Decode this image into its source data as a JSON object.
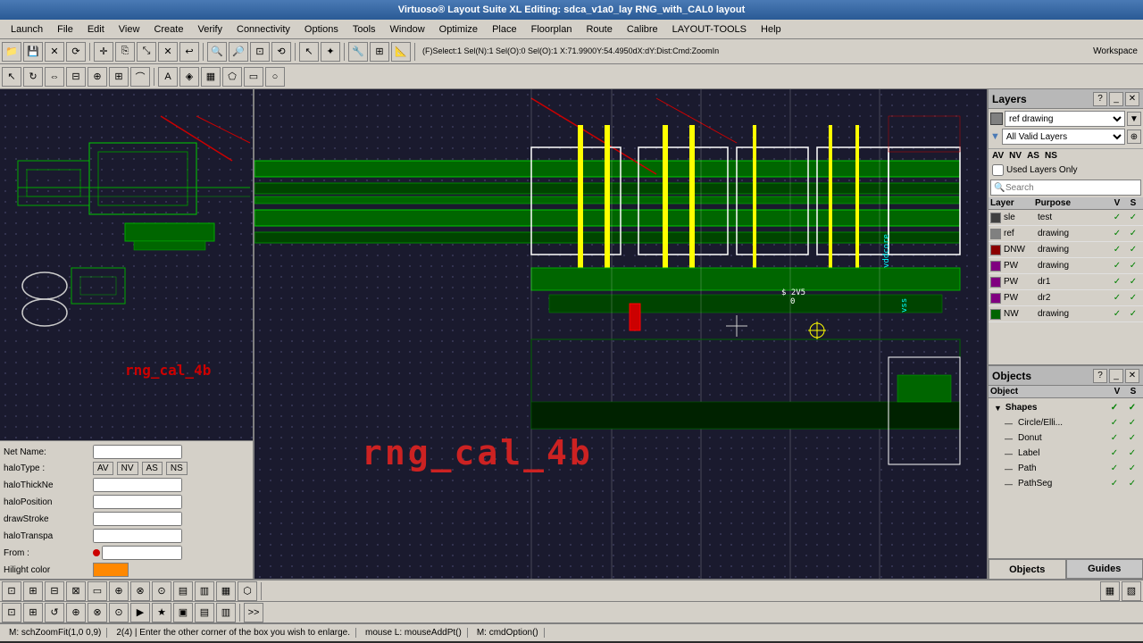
{
  "titlebar": {
    "text": "Virtuoso® Layout Suite XL Editing: sdca_v1a0_lay RNG_with_CAL0 layout"
  },
  "menubar": {
    "items": [
      "Launch",
      "File",
      "Edit",
      "View",
      "Create",
      "Verify",
      "Connectivity",
      "Options",
      "Tools",
      "Window",
      "Optimize",
      "Place",
      "Floorplan",
      "Route",
      "Calibre",
      "LAYOUT-TOOLS",
      "Help"
    ]
  },
  "toolbar": {
    "workspace_label": "Workspace",
    "net_name_label": "Net Name:",
    "halotype_label": "haloType :",
    "halotype_tabs": [
      "AV",
      "NV",
      "AS",
      "NS"
    ],
    "halothickne_label": "haloThickNe",
    "haloposition_label": "haloPosition",
    "drawstroke_label": "drawStroke",
    "halotranspa_label": "haloTranspa",
    "from_label": "From :",
    "hilight_color_label": "Hilight color"
  },
  "statusbar_top": {
    "text": "(F)Select:1 Sel(N):1 Sel(O):0 Sel(O):1  X:71.9900Y:54.4950dX:dY:Dist:Cmd:ZoomIn"
  },
  "layers_panel": {
    "title": "Layers",
    "filter_tabs": [
      "AV",
      "NV",
      "AS",
      "NS"
    ],
    "ref_drawing_label": "ref drawing",
    "all_valid_label": "All Valid Layers",
    "used_only_label": "Used Layers Only",
    "search_placeholder": "Search",
    "col_layer": "Layer",
    "col_purpose": "Purpose",
    "col_v": "V",
    "col_s": "S",
    "rows": [
      {
        "name": "sle",
        "purpose": "test",
        "v": true,
        "s": true,
        "color": "#404040"
      },
      {
        "name": "ref",
        "purpose": "drawing",
        "v": true,
        "s": true,
        "color": "#808080"
      },
      {
        "name": "DNW",
        "purpose": "drawing",
        "v": true,
        "s": true,
        "color": "#8B0000"
      },
      {
        "name": "PW",
        "purpose": "drawing",
        "v": true,
        "s": true,
        "color": "#800080"
      },
      {
        "name": "PW",
        "purpose": "dr1",
        "v": true,
        "s": true,
        "color": "#800080"
      },
      {
        "name": "PW",
        "purpose": "dr2",
        "v": true,
        "s": true,
        "color": "#800080"
      },
      {
        "name": "NW",
        "purpose": "drawing",
        "v": true,
        "s": true,
        "color": "#006400"
      }
    ]
  },
  "objects_panel": {
    "title": "Objects",
    "col_object": "Object",
    "col_v": "V",
    "col_s": "S",
    "tree": [
      {
        "label": "Shapes",
        "indent": 0,
        "parent": true,
        "v": true,
        "s": true
      },
      {
        "label": "Circle/Elli...",
        "indent": 1,
        "parent": false,
        "v": true,
        "s": true
      },
      {
        "label": "Donut",
        "indent": 1,
        "parent": false,
        "v": true,
        "s": true
      },
      {
        "label": "Label",
        "indent": 1,
        "parent": false,
        "v": true,
        "s": true
      },
      {
        "label": "Path",
        "indent": 1,
        "parent": false,
        "v": true,
        "s": true
      },
      {
        "label": "PathSeg",
        "indent": 1,
        "parent": false,
        "v": true,
        "s": true
      }
    ],
    "tab_objects": "Objects",
    "tab_guides": "Guides"
  },
  "statusbar_bottom": {
    "left_text": "M: schZoomFit(1,0 0,9)",
    "mid_text": "mouse L: mouseAddPt()",
    "right_text": "M: cmdOption()",
    "cmd_text": "2(4) |  Enter the other corner of the box you wish to enlarge."
  },
  "canvas": {
    "label_text": "rng_cal_4b"
  }
}
